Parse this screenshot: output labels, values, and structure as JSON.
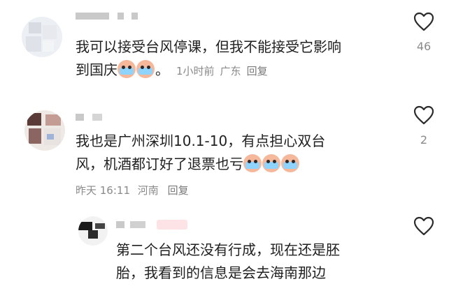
{
  "comments": [
    {
      "text_line1": "我可以接受台风停课，但我不能接受它影响",
      "text_line2": "到国庆",
      "text_after_emoji": "。",
      "time": "1小时前",
      "location": "广东",
      "reply_label": "回复",
      "likes": "46"
    },
    {
      "text_line1": "我也是广州深圳10.1-10，有点担心双台",
      "text_line2": "风，机酒都订好了退票也亏",
      "time": "昨天 16:11",
      "location": "河南",
      "reply_label": "回复",
      "likes": "2"
    },
    {
      "text_line1": "第二个台风还没有行成，现在还是胚",
      "text_line2": "胎，我看到的信息是会去海南那边"
    }
  ],
  "colors": {
    "heart_stroke": "#2b2b2b",
    "meta": "#8a8a8a",
    "emoji_tears": "#8fd3ff"
  },
  "icons": [
    "heart-outline-icon",
    "crying-emoji"
  ]
}
